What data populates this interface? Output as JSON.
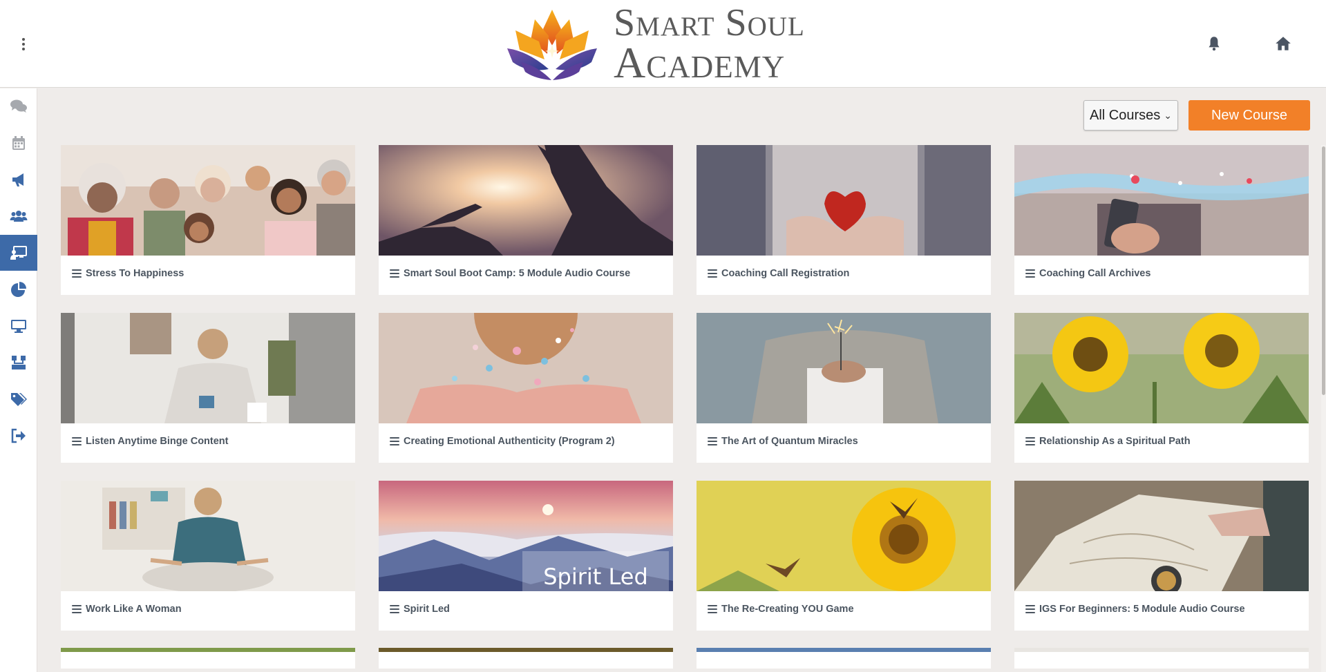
{
  "header": {
    "logo_line1": "Smart Soul",
    "logo_line2": "Academy",
    "menu_icon": "kebab-menu-icon",
    "notifications_icon": "bell-icon",
    "home_icon": "home-icon"
  },
  "sidebar": {
    "items": [
      {
        "name": "chat",
        "icon": "comments-icon",
        "active": false
      },
      {
        "name": "calendar",
        "icon": "calendar-icon",
        "active": false
      },
      {
        "name": "announcements",
        "icon": "megaphone-icon",
        "active": false
      },
      {
        "name": "members",
        "icon": "users-icon",
        "active": false
      },
      {
        "name": "courses",
        "icon": "chalkboard-teacher-icon",
        "active": true
      },
      {
        "name": "reports",
        "icon": "pie-chart-icon",
        "active": false
      },
      {
        "name": "webinars",
        "icon": "desktop-icon",
        "active": false
      },
      {
        "name": "organization",
        "icon": "sitemap-icon",
        "active": false
      },
      {
        "name": "tags",
        "icon": "tags-icon",
        "active": false
      },
      {
        "name": "logout",
        "icon": "sign-out-icon",
        "active": false
      }
    ],
    "active_color": "#3d6aa8",
    "icon_color": "#3d6aa8"
  },
  "toolbar": {
    "filter_value": "All Courses",
    "new_course_label": "New Course",
    "accent_color": "#f28028"
  },
  "courses": [
    {
      "title": "Stress To Happiness",
      "image": "group-of-smiling-people"
    },
    {
      "title": "Smart Soul Boot Camp: 5 Module Audio Course",
      "image": "helping-hand-on-mountain-at-sunset"
    },
    {
      "title": "Coaching Call Registration",
      "image": "hands-holding-red-heart"
    },
    {
      "title": "Coaching Call Archives",
      "image": "phone-with-social-network-lights"
    },
    {
      "title": "Listen Anytime Binge Content",
      "image": "woman-with-headphones-on-couch"
    },
    {
      "title": "Creating Emotional Authenticity (Program 2)",
      "image": "hands-blowing-confetti"
    },
    {
      "title": "The Art of Quantum Miracles",
      "image": "hands-holding-sparkler"
    },
    {
      "title": "Relationship As a Spiritual Path",
      "image": "sunflowers"
    },
    {
      "title": "Work Like A Woman",
      "image": "woman-meditating"
    },
    {
      "title": "Spirit Led",
      "image": "sunrise-over-clouds-and-mountains",
      "overlay_text": "Spirit Led"
    },
    {
      "title": "The Re-Creating YOU Game",
      "image": "sunflower-with-butterflies"
    },
    {
      "title": "IGS For Beginners: 5 Module Audio Course",
      "image": "hands-on-map-with-compass"
    }
  ]
}
